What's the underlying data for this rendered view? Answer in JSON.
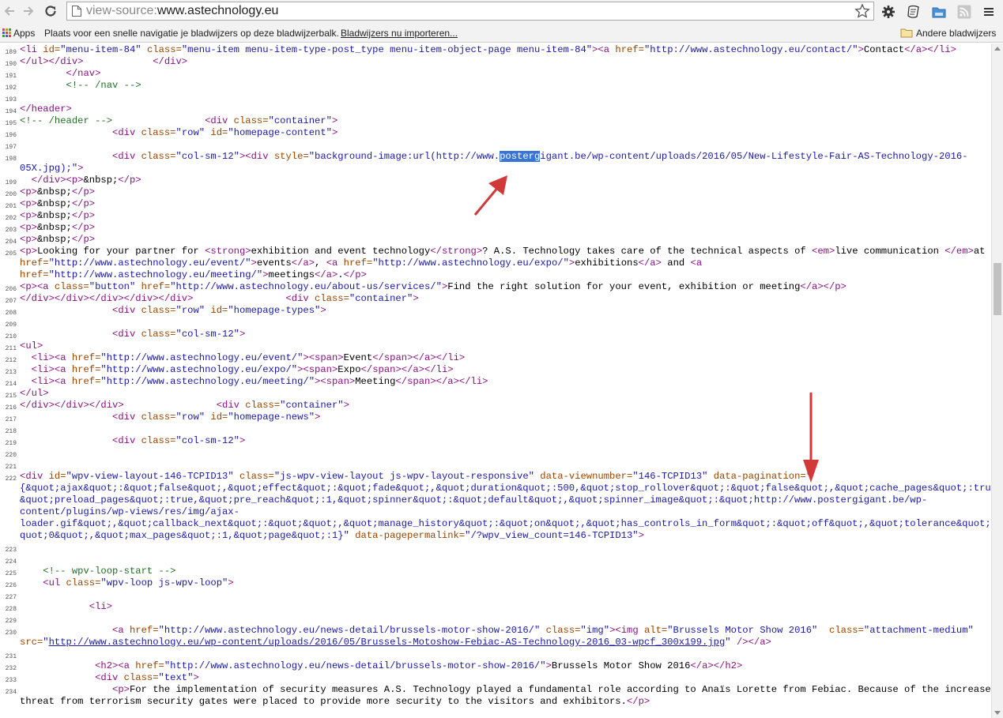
{
  "browser": {
    "url_scheme": "view-source:",
    "url_host": "www.astechnology.eu",
    "bookmarks_bar": {
      "apps_label": "Apps",
      "hint_text": "Plaats voor een snelle navigatie je bladwijzers op deze bladwijzerbalk.",
      "import_link": "Bladwijzers nu importeren...",
      "other_bookmarks": "Andere bladwijzers"
    }
  },
  "source_lines": [
    {
      "n": "189",
      "html": "<span class=\"t\">&lt;li </span><span class=\"a\">id=</span><span class=\"v\">\"menu-item-84\"</span><span class=\"a\"> class=</span><span class=\"v\">\"menu-item menu-item-type-post_type menu-item-object-page menu-item-84\"</span><span class=\"t\">&gt;&lt;a </span><span class=\"a\">href=</span><span class=\"v\">\"http://www.astechnology.eu/contact/\"</span><span class=\"t\">&gt;</span>Contact<span class=\"t\">&lt;/a&gt;&lt;/li&gt;</span>"
    },
    {
      "n": "190",
      "html": "<span class=\"t\">&lt;/ul&gt;&lt;/div&gt;</span>            <span class=\"t\">&lt;/div&gt;</span>"
    },
    {
      "n": "191",
      "html": "        <span class=\"t\">&lt;/nav&gt;</span>"
    },
    {
      "n": "192",
      "html": "        <span class=\"c\">&lt;!-- /nav --&gt;</span>"
    },
    {
      "n": "193",
      "html": ""
    },
    {
      "n": "194",
      "html": "<span class=\"t\">&lt;/header&gt;</span>"
    },
    {
      "n": "195",
      "html": "<span class=\"c\">&lt;!-- /header --&gt;</span>                <span class=\"t\">&lt;div </span><span class=\"a\">class=</span><span class=\"v\">\"container\"</span><span class=\"t\">&gt;</span>"
    },
    {
      "n": "196",
      "html": "                <span class=\"t\">&lt;div </span><span class=\"a\">class=</span><span class=\"v\">\"row\"</span><span class=\"a\"> id=</span><span class=\"v\">\"homepage-content\"</span><span class=\"t\">&gt;</span>"
    },
    {
      "n": "197",
      "html": ""
    },
    {
      "n": "198",
      "html": "                <span class=\"t\">&lt;div </span><span class=\"a\">class=</span><span class=\"v\">\"col-sm-12\"</span><span class=\"t\">&gt;&lt;div </span><span class=\"a\">style=</span><span class=\"v\">\"background-image:url(http://www.<span class=\"hl\">posterg</span>igant.be/wp-content/uploads/2016/05/New-Lifestyle-Fair-AS-Technology-2016-</span>"
    },
    {
      "n": "",
      "html": "<span class=\"v\">05X.jpg);\"</span><span class=\"t\">&gt;</span>"
    },
    {
      "n": "199",
      "html": "  <span class=\"t\">&lt;/div&gt;&lt;p&gt;</span>&amp;nbsp;<span class=\"t\">&lt;/p&gt;</span>"
    },
    {
      "n": "200",
      "html": "<span class=\"t\">&lt;p&gt;</span>&amp;nbsp;<span class=\"t\">&lt;/p&gt;</span>"
    },
    {
      "n": "201",
      "html": "<span class=\"t\">&lt;p&gt;</span>&amp;nbsp;<span class=\"t\">&lt;/p&gt;</span>"
    },
    {
      "n": "202",
      "html": "<span class=\"t\">&lt;p&gt;</span>&amp;nbsp;<span class=\"t\">&lt;/p&gt;</span>"
    },
    {
      "n": "203",
      "html": "<span class=\"t\">&lt;p&gt;</span>&amp;nbsp;<span class=\"t\">&lt;/p&gt;</span>"
    },
    {
      "n": "204",
      "html": "<span class=\"t\">&lt;p&gt;</span>&amp;nbsp;<span class=\"t\">&lt;/p&gt;</span>"
    },
    {
      "n": "205",
      "html": "<span class=\"t\">&lt;p&gt;</span>Looking for your partner for <span class=\"t\">&lt;strong&gt;</span>exhibition and event technology<span class=\"t\">&lt;/strong&gt;</span>? A.S. Technology takes care of the technical aspects of <span class=\"t\">&lt;em&gt;</span>live communication <span class=\"t\">&lt;/em&gt;</span>at <span class=\"t\">&lt;a</span>"
    },
    {
      "n": "",
      "html": "<span class=\"a\">href=</span><span class=\"v\">\"http://www.astechnology.eu/event/\"</span><span class=\"t\">&gt;</span>events<span class=\"t\">&lt;/a&gt;</span>, <span class=\"t\">&lt;a </span><span class=\"a\">href=</span><span class=\"v\">\"http://www.astechnology.eu/expo/\"</span><span class=\"t\">&gt;</span>exhibitions<span class=\"t\">&lt;/a&gt;</span> and <span class=\"t\">&lt;a</span>"
    },
    {
      "n": "",
      "html": "<span class=\"a\">href=</span><span class=\"v\">\"http://www.astechnology.eu/meeting/\"</span><span class=\"t\">&gt;</span>meetings<span class=\"t\">&lt;/a&gt;</span>.<span class=\"t\">&lt;/p&gt;</span>"
    },
    {
      "n": "206",
      "html": "<span class=\"t\">&lt;p&gt;&lt;a </span><span class=\"a\">class=</span><span class=\"v\">\"button\"</span><span class=\"a\"> href=</span><span class=\"v\">\"http://www.astechnology.eu/about-us/services/\"</span><span class=\"t\">&gt;</span>Find the right solution for your event, exhibition or meeting<span class=\"t\">&lt;/a&gt;&lt;/p&gt;</span>"
    },
    {
      "n": "207",
      "html": "<span class=\"t\">&lt;/div&gt;&lt;/div&gt;&lt;/div&gt;&lt;/div&gt;&lt;/div&gt;</span>                <span class=\"t\">&lt;div </span><span class=\"a\">class=</span><span class=\"v\">\"container\"</span><span class=\"t\">&gt;</span>"
    },
    {
      "n": "208",
      "html": "                <span class=\"t\">&lt;div </span><span class=\"a\">class=</span><span class=\"v\">\"row\"</span><span class=\"a\"> id=</span><span class=\"v\">\"homepage-types\"</span><span class=\"t\">&gt;</span>"
    },
    {
      "n": "209",
      "html": ""
    },
    {
      "n": "210",
      "html": "                <span class=\"t\">&lt;div </span><span class=\"a\">class=</span><span class=\"v\">\"col-sm-12\"</span><span class=\"t\">&gt;</span>"
    },
    {
      "n": "211",
      "html": "<span class=\"t\">&lt;ul&gt;</span>"
    },
    {
      "n": "212",
      "html": "  <span class=\"t\">&lt;li&gt;&lt;a </span><span class=\"a\">href=</span><span class=\"v\">\"http://www.astechnology.eu/event/\"</span><span class=\"t\">&gt;&lt;span&gt;</span>Event<span class=\"t\">&lt;/span&gt;&lt;/a&gt;&lt;/li&gt;</span>"
    },
    {
      "n": "213",
      "html": "  <span class=\"t\">&lt;li&gt;&lt;a </span><span class=\"a\">href=</span><span class=\"v\">\"http://www.astechnology.eu/expo/\"</span><span class=\"t\">&gt;&lt;span&gt;</span>Expo<span class=\"t\">&lt;/span&gt;&lt;/a&gt;&lt;/li&gt;</span>"
    },
    {
      "n": "214",
      "html": "  <span class=\"t\">&lt;li&gt;&lt;a </span><span class=\"a\">href=</span><span class=\"v\">\"http://www.astechnology.eu/meeting/\"</span><span class=\"t\">&gt;&lt;span&gt;</span>Meeting<span class=\"t\">&lt;/span&gt;&lt;/a&gt;&lt;/li&gt;</span>"
    },
    {
      "n": "215",
      "html": "<span class=\"t\">&lt;/ul&gt;</span>"
    },
    {
      "n": "216",
      "html": "<span class=\"t\">&lt;/div&gt;&lt;/div&gt;&lt;/div&gt;</span>                <span class=\"t\">&lt;div </span><span class=\"a\">class=</span><span class=\"v\">\"container\"</span><span class=\"t\">&gt;</span>"
    },
    {
      "n": "217",
      "html": "                <span class=\"t\">&lt;div </span><span class=\"a\">class=</span><span class=\"v\">\"row\"</span><span class=\"a\"> id=</span><span class=\"v\">\"homepage-news\"</span><span class=\"t\">&gt;</span>"
    },
    {
      "n": "218",
      "html": ""
    },
    {
      "n": "219",
      "html": "                <span class=\"t\">&lt;div </span><span class=\"a\">class=</span><span class=\"v\">\"col-sm-12\"</span><span class=\"t\">&gt;</span>"
    },
    {
      "n": "220",
      "html": ""
    },
    {
      "n": "221",
      "html": ""
    },
    {
      "n": "222",
      "html": "<span class=\"t\">&lt;div </span><span class=\"a\">id=</span><span class=\"v\">\"wpv-view-layout-146-TCPID13\"</span><span class=\"a\"> class=</span><span class=\"v\">\"js-wpv-view-layout js-wpv-layout-responsive\"</span><span class=\"a\"> data-viewnumber=</span><span class=\"v\">\"146-TCPID13\"</span><span class=\"a\"> data-pagination=</span><span class=\"v\">\"</span>"
    },
    {
      "n": "",
      "html": "<span class=\"v\">{&amp;quot;ajax&amp;quot;:&amp;quot;false&amp;quot;,&amp;quot;effect&amp;quot;:&amp;quot;fade&amp;quot;,&amp;quot;duration&amp;quot;:500,&amp;quot;stop_rollover&amp;quot;:&amp;quot;false&amp;quot;,&amp;quot;cache_pages&amp;quot;:true,</span>"
    },
    {
      "n": "",
      "html": "<span class=\"v\">&amp;quot;preload_pages&amp;quot;:true,&amp;quot;pre_reach&amp;quot;:1,&amp;quot;spinner&amp;quot;:&amp;quot;default&amp;quot;,&amp;quot;spinner_image&amp;quot;:&amp;quot;http://www.postergigant.be/wp-</span>"
    },
    {
      "n": "",
      "html": "<span class=\"v\">content/plugins/wp-views/res/img/ajax-</span>"
    },
    {
      "n": "",
      "html": "<span class=\"v\">loader.gif&amp;quot;,&amp;quot;callback_next&amp;quot;:&amp;quot;&amp;quot;,&amp;quot;manage_history&amp;quot;:&amp;quot;on&amp;quot;,&amp;quot;has_controls_in_form&amp;quot;:&amp;quot;off&amp;quot;,&amp;quot;tolerance&amp;quot;:&amp;</span>"
    },
    {
      "n": "",
      "html": "<span class=\"v\">quot;0&amp;quot;,&amp;quot;max_pages&amp;quot;:1,&amp;quot;page&amp;quot;:1}\"</span><span class=\"a\"> data-pagepermalink=</span><span class=\"v\">\"/?wpv_view_count=146-TCPID13\"</span><span class=\"t\">&gt;</span>"
    },
    {
      "n": "223",
      "html": ""
    },
    {
      "n": "224",
      "html": ""
    },
    {
      "n": "225",
      "html": "    <span class=\"c\">&lt;!-- wpv-loop-start --&gt;</span>"
    },
    {
      "n": "226",
      "html": "    <span class=\"t\">&lt;ul </span><span class=\"a\">class=</span><span class=\"v\">\"wpv-loop js-wpv-loop\"</span><span class=\"t\">&gt;</span>"
    },
    {
      "n": "227",
      "html": ""
    },
    {
      "n": "228",
      "html": "            <span class=\"t\">&lt;li&gt;</span>"
    },
    {
      "n": "229",
      "html": ""
    },
    {
      "n": "230",
      "html": "                <span class=\"t\">&lt;a </span><span class=\"a\">href=</span><span class=\"v\">\"http://www.astechnology.eu/news-detail/brussels-motor-show-2016/\"</span><span class=\"a\"> class=</span><span class=\"v\">\"img\"</span><span class=\"t\">&gt;&lt;img </span><span class=\"a\">alt=</span><span class=\"v\">\"Brussels Motor Show 2016\"</span><span class=\"a\">  class=</span><span class=\"v\">\"attachment-medium\"</span>"
    },
    {
      "n": "",
      "html": "<span class=\"a\">src=</span><span class=\"v\">\"</span><span class=\"l\">http://www.astechnology.eu/wp-content/uploads/2016/05/Brussels-Motoshow-Febiac-AS-Technology-2016_03-wpcf_300x199.jpg</span><span class=\"v\">\"</span><span class=\"t\"> /&gt;&lt;/a&gt;</span>"
    },
    {
      "n": "231",
      "html": ""
    },
    {
      "n": "232",
      "html": "             <span class=\"t\">&lt;h2&gt;&lt;a </span><span class=\"a\">href=</span><span class=\"v\">\"http://www.astechnology.eu/news-detail/brussels-motor-show-2016/\"</span><span class=\"t\">&gt;</span>Brussels Motor Show 2016<span class=\"t\">&lt;/a&gt;&lt;/h2&gt;</span>"
    },
    {
      "n": "233",
      "html": "             <span class=\"t\">&lt;div </span><span class=\"a\">class=</span><span class=\"v\">\"text\"</span><span class=\"t\">&gt;</span>"
    },
    {
      "n": "234",
      "html": "                <span class=\"t\">&lt;p&gt;</span>For the implementation of security measures A.S. Technology played a fundamental role according to Anaïs Lorette from Febiac. Because of the increased"
    },
    {
      "n": "",
      "html": "threat from terrorism security gates were placed to provide more security to the visitors and exhibitors.<span class=\"t\">&lt;/p&gt;</span>"
    }
  ]
}
